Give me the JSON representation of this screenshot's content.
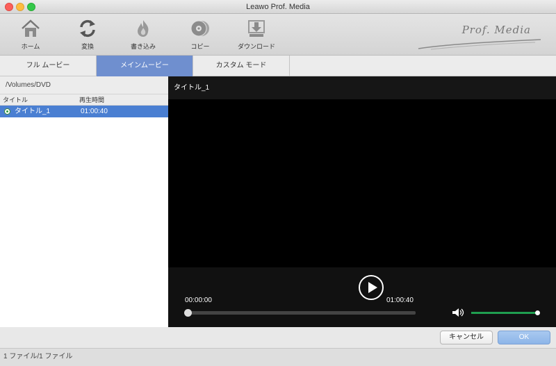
{
  "window": {
    "title": "Leawo Prof. Media"
  },
  "toolbar": {
    "items": [
      {
        "label": "ホーム",
        "icon": "home-icon"
      },
      {
        "label": "変換",
        "icon": "convert-icon"
      },
      {
        "label": "書き込み",
        "icon": "burn-icon"
      },
      {
        "label": "コピー",
        "icon": "copy-disc-icon"
      },
      {
        "label": "ダウンロード",
        "icon": "download-icon"
      }
    ],
    "logo": "Prof. Media"
  },
  "tabs": [
    {
      "label": "フル ムービー",
      "active": false
    },
    {
      "label": "メインムービー",
      "active": true
    },
    {
      "label": "カスタム モード",
      "active": false
    }
  ],
  "source": {
    "path": "/Volumes/DVD",
    "columns": {
      "title": "タイトル",
      "duration": "再生時間"
    },
    "rows": [
      {
        "title": "タイトル_1",
        "duration": "01:00:40",
        "selected": true
      }
    ]
  },
  "player": {
    "title": "タイトル_1",
    "current_time": "00:00:00",
    "total_time": "01:00:40",
    "progress": 0,
    "volume": 1.0
  },
  "buttons": {
    "cancel": "キャンセル",
    "ok": "OK"
  },
  "status": {
    "text": "1 ファイル/1 ファイル"
  },
  "colors": {
    "accent": "#6f8fcf",
    "selection": "#4a7fd2",
    "volume": "#1f9e4f"
  }
}
